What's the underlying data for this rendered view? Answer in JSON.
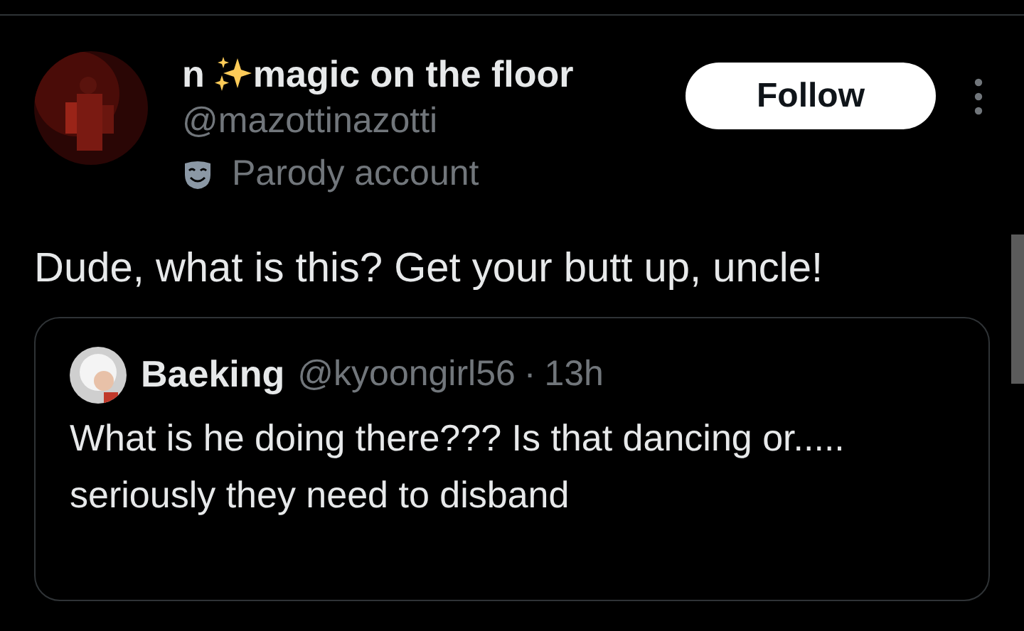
{
  "author": {
    "name_prefix": "n",
    "name": "magic on the floor",
    "handle": "@mazottinazotti",
    "label": "Parody account"
  },
  "follow_button": "Follow",
  "text": "Dude, what is this? Get your butt up, uncle!",
  "quote": {
    "name": "Baeking",
    "handle": "@kyoongirl56",
    "separator": "·",
    "time": "13h",
    "text": "What is he doing there??? Is that dancing or..... seriously they need to disband"
  }
}
